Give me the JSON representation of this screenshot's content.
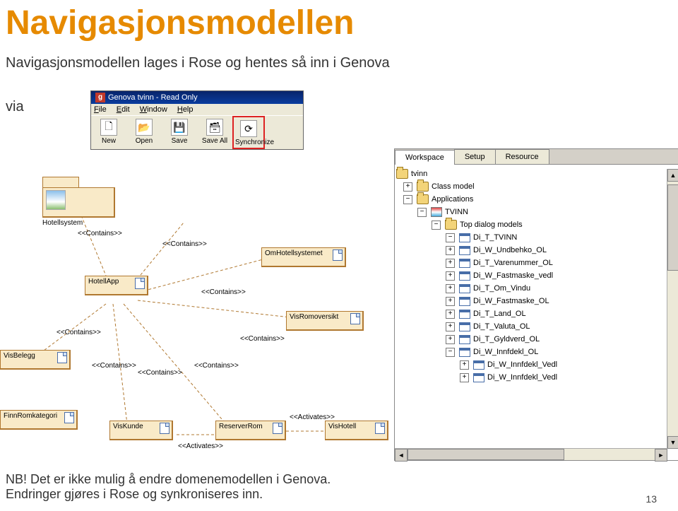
{
  "title": "Navigasjonsmodellen",
  "subtitle": "Navigasjonsmodellen lages i Rose og hentes så inn i Genova",
  "via": "via",
  "footnote1": "NB! Det er ikke mulig å endre domenemodellen i Genova.",
  "footnote2": "Endringer gjøres i Rose og synkroniseres inn.",
  "pagenum": "13",
  "window": {
    "title": "Genova tvinn - Read Only",
    "menus": {
      "file": "File",
      "edit": "Edit",
      "window": "Window",
      "help": "Help"
    },
    "toolbar": {
      "new": "New",
      "open": "Open",
      "save": "Save",
      "saveall": "Save All",
      "sync": "Synchronize"
    }
  },
  "diagram": {
    "hotellsystem": "Hotellsystem",
    "hotellapp": "HotellApp",
    "omhotell": "OmHotellsystemet",
    "visromoversikt": "VisRomoversikt",
    "visbelegg": "VisBelegg",
    "finnromkategori": "FinnRomkategori",
    "viskunde": "VisKunde",
    "reserverrom": "ReserverRom",
    "vishotell": "VisHotell",
    "contains": "<<Contains>>",
    "activates": "<<Activates>>"
  },
  "tree": {
    "tabs": {
      "workspace": "Workspace",
      "setup": "Setup",
      "resource": "Resource"
    },
    "root": "tvinn",
    "classmodel": "Class model",
    "applications": "Applications",
    "tvinnapp": "TVINN",
    "topdialog": "Top dialog models",
    "items": [
      "Di_T_TVINN",
      "Di_W_Undbehko_OL",
      "Di_T_Varenummer_OL",
      "Di_W_Fastmaske_vedl",
      "Di_T_Om_Vindu",
      "Di_W_Fastmaske_OL",
      "Di_T_Land_OL",
      "Di_T_Valuta_OL",
      "Di_T_Gyldverd_OL",
      "Di_W_Innfdekl_OL",
      "Di_W_Innfdekl_Vedl",
      "Di_W_Innfdekl_Vedl"
    ]
  }
}
